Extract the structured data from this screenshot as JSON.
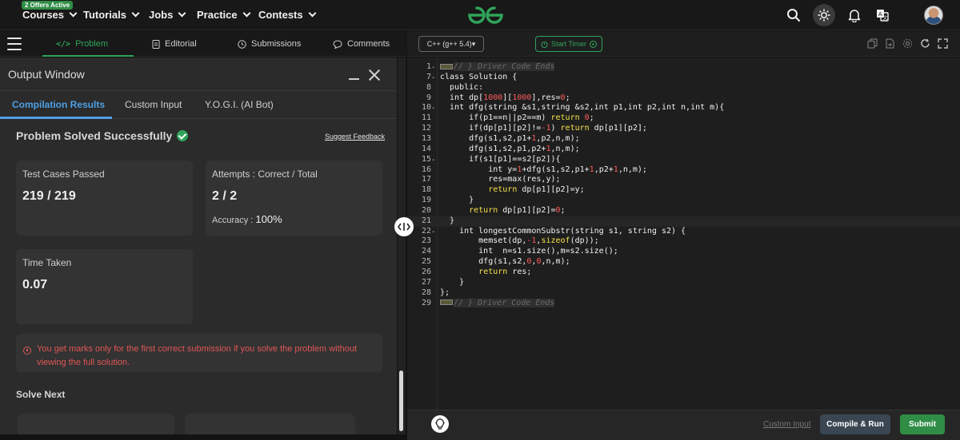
{
  "topnav": {
    "offer_badge": "2 Offers Active",
    "items": [
      {
        "label": "Courses"
      },
      {
        "label": "Tutorials"
      },
      {
        "label": "Jobs"
      },
      {
        "label": "Practice"
      },
      {
        "label": "Contests"
      }
    ],
    "icons": [
      "search-icon",
      "theme-toggle-icon",
      "bell-icon",
      "translate-icon",
      "avatar"
    ]
  },
  "left_tabs": [
    {
      "label": "Problem",
      "icon": "code-icon",
      "active": true
    },
    {
      "label": "Editorial",
      "icon": "document-icon"
    },
    {
      "label": "Submissions",
      "icon": "clock-icon"
    },
    {
      "label": "Comments",
      "icon": "comment-icon"
    }
  ],
  "output": {
    "title": "Output Window",
    "tabs": [
      "Compilation Results",
      "Custom Input",
      "Y.O.G.I. (AI Bot)"
    ],
    "status": "Problem Solved Successfully",
    "suggest_feedback": "Suggest Feedback",
    "test_cases_label": "Test Cases Passed",
    "test_cases_value": "219 / 219",
    "attempts_label": "Attempts : Correct / Total",
    "attempts_value": "2 / 2",
    "accuracy_label": "Accuracy :",
    "accuracy_value": "100%",
    "time_label": "Time Taken",
    "time_value": "0.07",
    "alert": "You get marks only for the first correct submission if you solve the problem without viewing the full solution.",
    "solve_next": "Solve Next"
  },
  "editor": {
    "language": "C++ (g++ 5.4)",
    "timer": "Start Timer",
    "lines": [
      {
        "n": "1",
        "fold": true,
        "code": "// } Driver Code Ends",
        "type": "folded"
      },
      {
        "n": "7",
        "fold": true,
        "code": "class Solution {"
      },
      {
        "n": "8",
        "code": "  public:"
      },
      {
        "n": "9",
        "code": "  int dp[1000][1000],res=0;"
      },
      {
        "n": "10",
        "fold": true,
        "code": "  int dfg(string &s1,string &s2,int p1,int p2,int n,int m){"
      },
      {
        "n": "11",
        "code": "      if(p1==n||p2==m) return 0;"
      },
      {
        "n": "12",
        "code": "      if(dp[p1][p2]!=-1) return dp[p1][p2];"
      },
      {
        "n": "13",
        "code": "      dfg(s1,s2,p1+1,p2,n,m);"
      },
      {
        "n": "14",
        "code": "      dfg(s1,s2,p1,p2+1,n,m);"
      },
      {
        "n": "15",
        "fold": true,
        "code": "      if(s1[p1]==s2[p2]){"
      },
      {
        "n": "16",
        "code": "          int y=1+dfg(s1,s2,p1+1,p2+1,n,m);"
      },
      {
        "n": "17",
        "code": "          res=max(res,y);"
      },
      {
        "n": "18",
        "code": "          return dp[p1][p2]=y;"
      },
      {
        "n": "19",
        "code": "      }"
      },
      {
        "n": "20",
        "code": "      return dp[p1][p2]=0;"
      },
      {
        "n": "21",
        "code": "  }",
        "current": true
      },
      {
        "n": "22",
        "fold": true,
        "code": "    int longestCommonSubstr(string s1, string s2) {"
      },
      {
        "n": "23",
        "code": "        memset(dp,-1,sizeof(dp));"
      },
      {
        "n": "24",
        "code": "        int  n=s1.size(),m=s2.size();"
      },
      {
        "n": "25",
        "code": "        dfg(s1,s2,0,0,n,m);"
      },
      {
        "n": "26",
        "code": "        return res;"
      },
      {
        "n": "27",
        "code": "    }"
      },
      {
        "n": "28",
        "code": "};"
      },
      {
        "n": "29",
        "code": "// } Driver Code Ends",
        "type": "folded"
      }
    ],
    "custom_input": "Custom Input",
    "compile_run": "Compile & Run",
    "submit": "Submit"
  },
  "colors": {
    "accent_green": "#2fa45a",
    "link_blue": "#4e9fe6",
    "error_red": "#e05555",
    "keyword_yellow": "#f5e04a",
    "number_red": "#ff5c5c"
  }
}
